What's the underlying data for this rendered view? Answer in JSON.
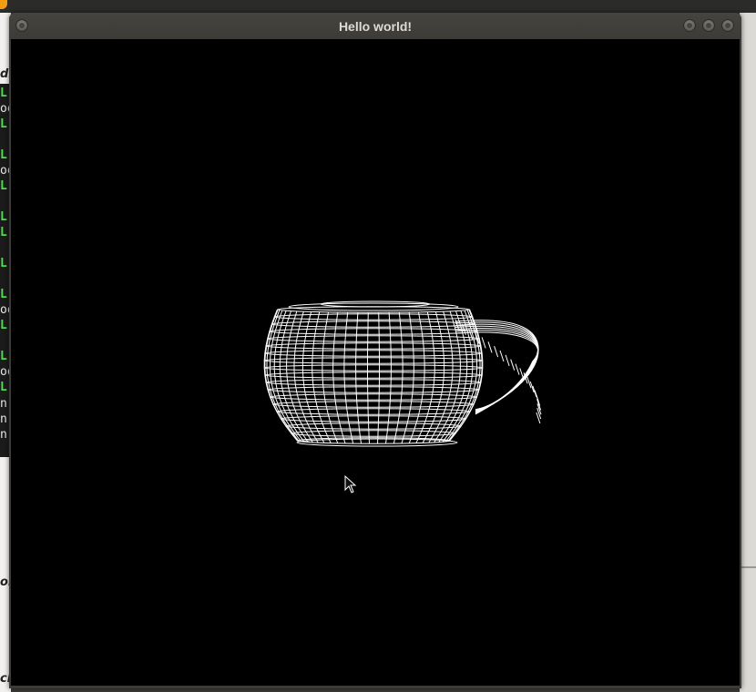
{
  "window": {
    "title": "Hello world!",
    "buttons": [
      "menu",
      "minimize",
      "maximize",
      "close"
    ]
  },
  "background_fragments": {
    "left_labels": [
      "dit",
      "ol",
      "ci"
    ],
    "console_lines": [
      {
        "text": "L",
        "color": "#4ce04c"
      },
      {
        "text": "oo",
        "color": "#e8e8e8"
      },
      {
        "text": "L",
        "color": "#4ce04c"
      },
      {
        "text": "L",
        "color": "#4ce04c"
      },
      {
        "text": "oo",
        "color": "#e8e8e8"
      },
      {
        "text": "L",
        "color": "#4ce04c"
      },
      {
        "text": "L",
        "color": "#4ce04c"
      },
      {
        "text": "L",
        "color": "#4ce04c"
      },
      {
        "text": "L",
        "color": "#4ce04c"
      },
      {
        "text": "L",
        "color": "#4ce04c"
      },
      {
        "text": "oo",
        "color": "#e8e8e8"
      },
      {
        "text": "L",
        "color": "#4ce04c"
      },
      {
        "text": "L",
        "color": "#4ce04c"
      },
      {
        "text": "oo",
        "color": "#e8e8e8"
      },
      {
        "text": "L",
        "color": "#4ce04c"
      },
      {
        "text": "n",
        "color": "#e8e8e8"
      },
      {
        "text": "n",
        "color": "#e8e8e8"
      },
      {
        "text": "n",
        "color": "#e8e8e8"
      }
    ]
  },
  "render": {
    "subject": "wireframe teacup",
    "background": "#000000",
    "line_color": "#ffffff"
  },
  "colors": {
    "titlebar": "#3c3b37",
    "title_text": "#dfdbd2",
    "console_green": "#4ce04c"
  }
}
